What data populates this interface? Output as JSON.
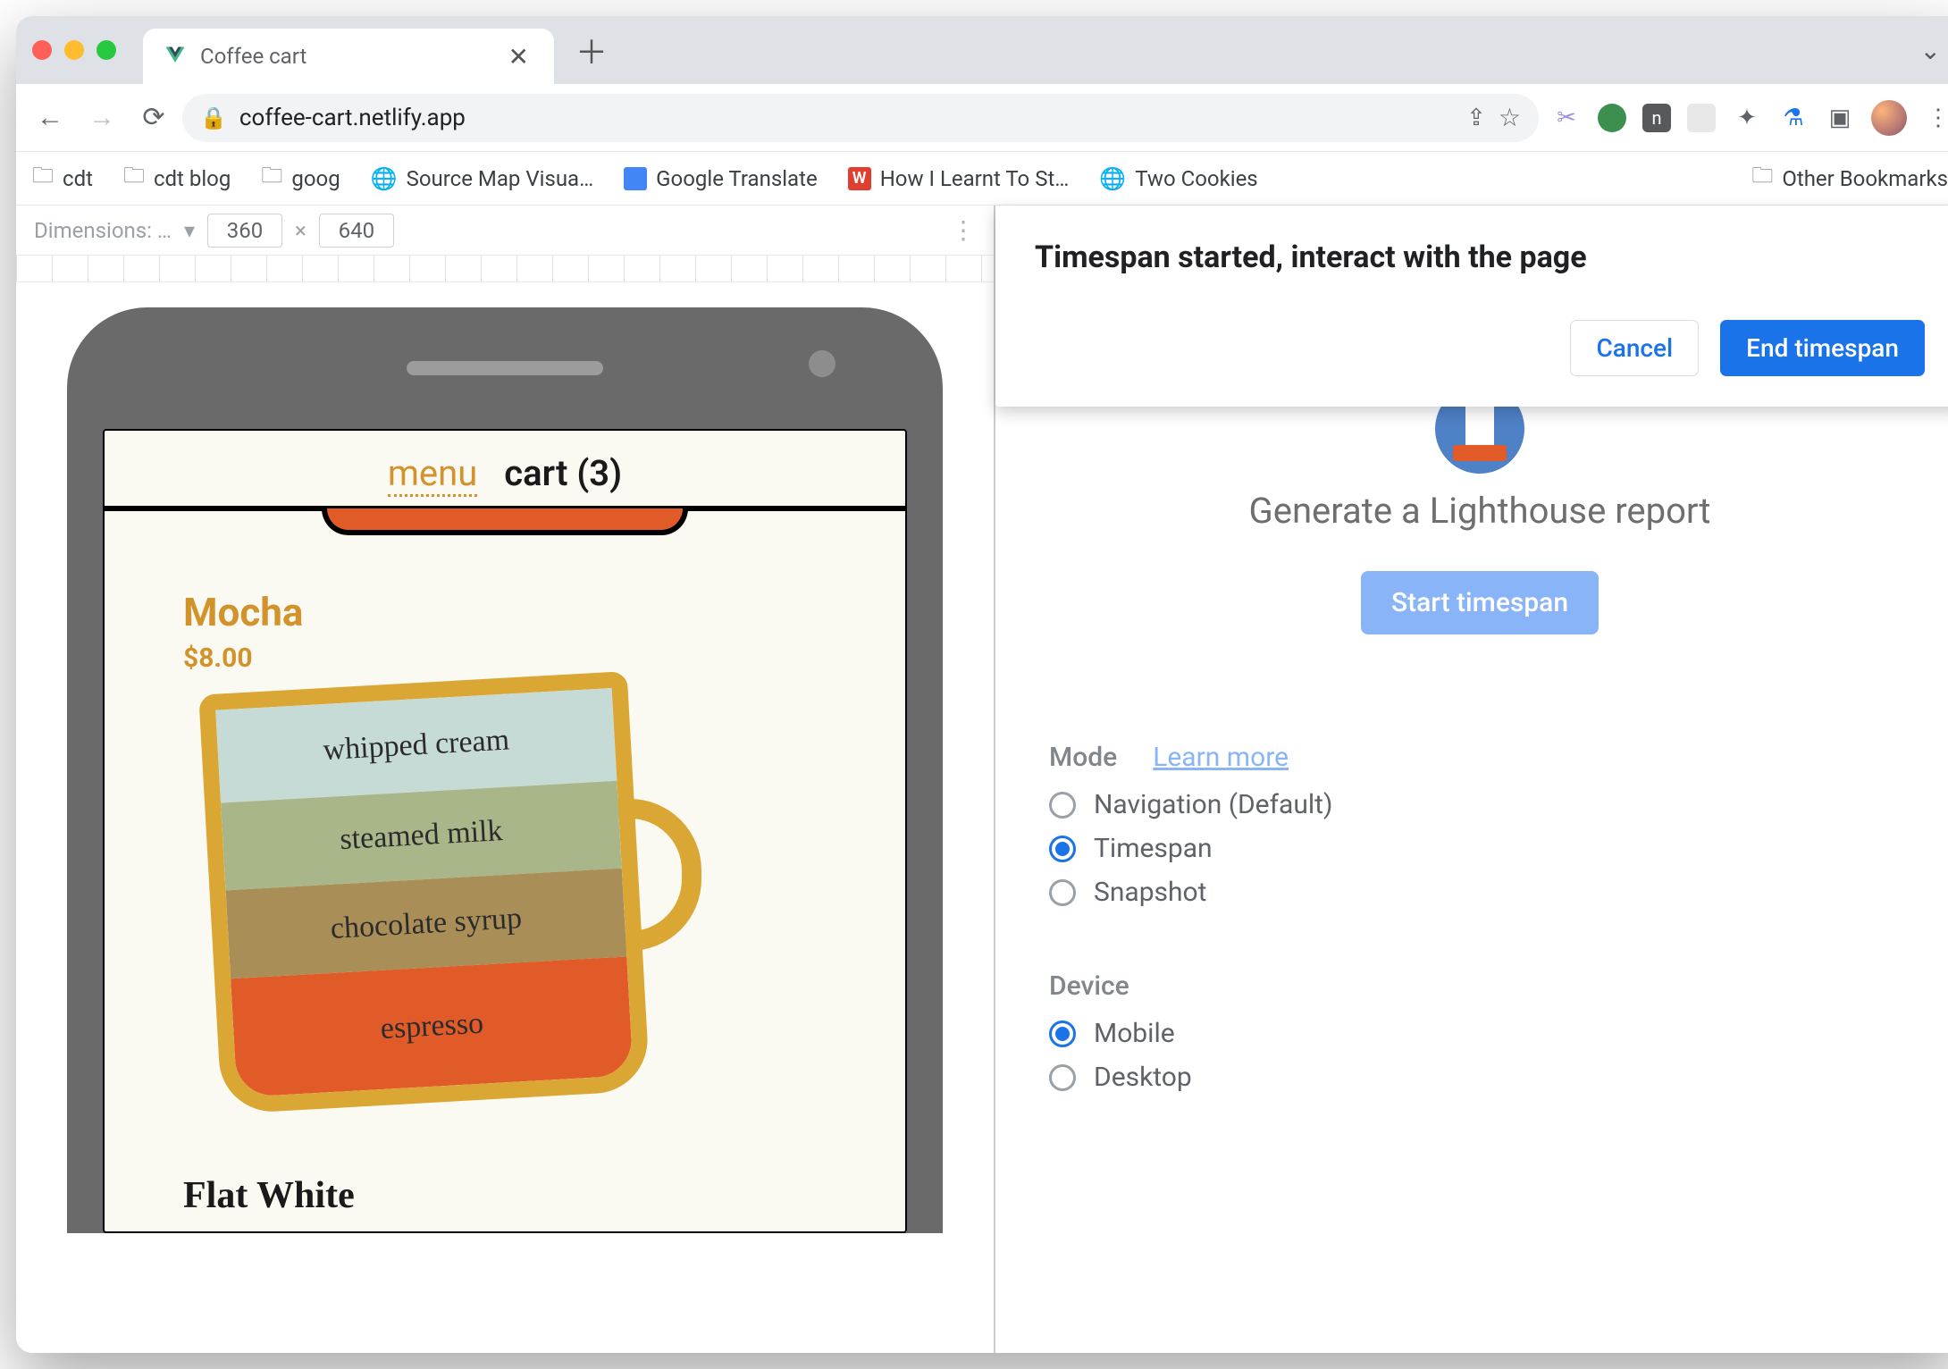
{
  "traffic_colors": {
    "close": "#ff5f57",
    "min": "#febc2e",
    "max": "#28c840"
  },
  "tab": {
    "title": "Coffee cart"
  },
  "addr": {
    "url": "coffee-cart.netlify.app"
  },
  "bookmarks": {
    "items": [
      "cdt",
      "cdt blog",
      "goog",
      "Source Map Visua…",
      "Google Translate",
      "How I Learnt To St…",
      "Two Cookies"
    ],
    "other": "Other Bookmarks"
  },
  "device": {
    "label": "Dimensions: …",
    "width": "360",
    "height": "640"
  },
  "page": {
    "nav": {
      "menu": "menu",
      "cart": "cart (3)"
    },
    "product": {
      "name": "Mocha",
      "price": "$8.00",
      "layers": [
        "whipped cream",
        "steamed milk",
        "chocolate syrup",
        "espresso"
      ]
    },
    "next_product": "Flat White"
  },
  "dialog": {
    "title": "Timespan started, interact with the page",
    "cancel": "Cancel",
    "confirm": "End timespan"
  },
  "lighthouse": {
    "heading": "Generate a Lighthouse report",
    "start": "Start timespan",
    "mode_label": "Mode",
    "learn_more": "Learn more",
    "modes": [
      "Navigation (Default)",
      "Timespan",
      "Snapshot"
    ],
    "mode_selected": 1,
    "device_label": "Device",
    "devices": [
      "Mobile",
      "Desktop"
    ],
    "device_selected": 0
  }
}
